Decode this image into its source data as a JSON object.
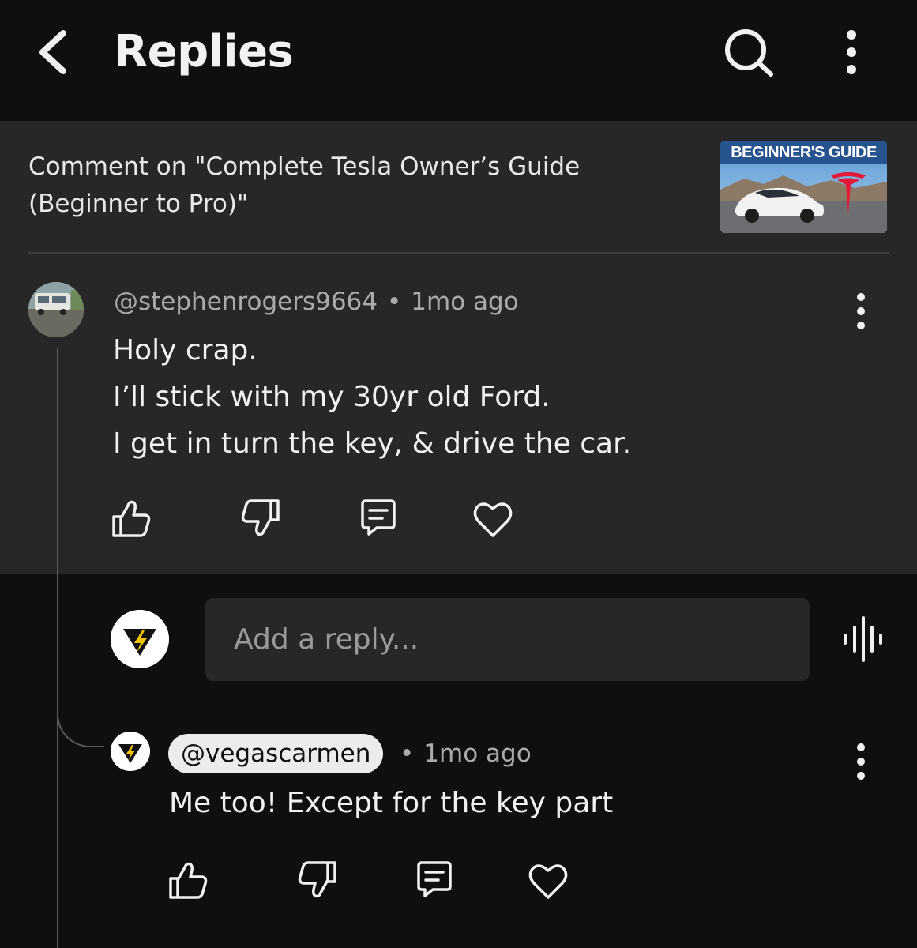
{
  "header": {
    "title": "Replies",
    "back_icon": "back-arrow-icon",
    "search_icon": "search-icon",
    "more_icon": "more-vertical-icon"
  },
  "context": {
    "text": "Comment on \"Complete Tesla Owner’s Guide (Beginner to Pro)\"",
    "thumbnail_label": "BEGINNER'S GUIDE"
  },
  "parent_comment": {
    "author": "@stephenrogers9664",
    "separator": "•",
    "time": "1mo ago",
    "lines": [
      "Holy crap.",
      "I’ll stick with my 30yr old Ford.",
      "I get in turn the key, & drive the car."
    ]
  },
  "reply_box": {
    "placeholder": "Add a reply..."
  },
  "reply_comment": {
    "author": "@vegascarmen",
    "separator": "•",
    "time": "1mo ago",
    "text": "Me too! Except for the key part"
  },
  "colors": {
    "background": "#0f0f0f",
    "surface": "#272727",
    "text": "#f1f1f1",
    "secondary_text": "#aaaaaa",
    "brand_yellow": "#f5c400"
  }
}
